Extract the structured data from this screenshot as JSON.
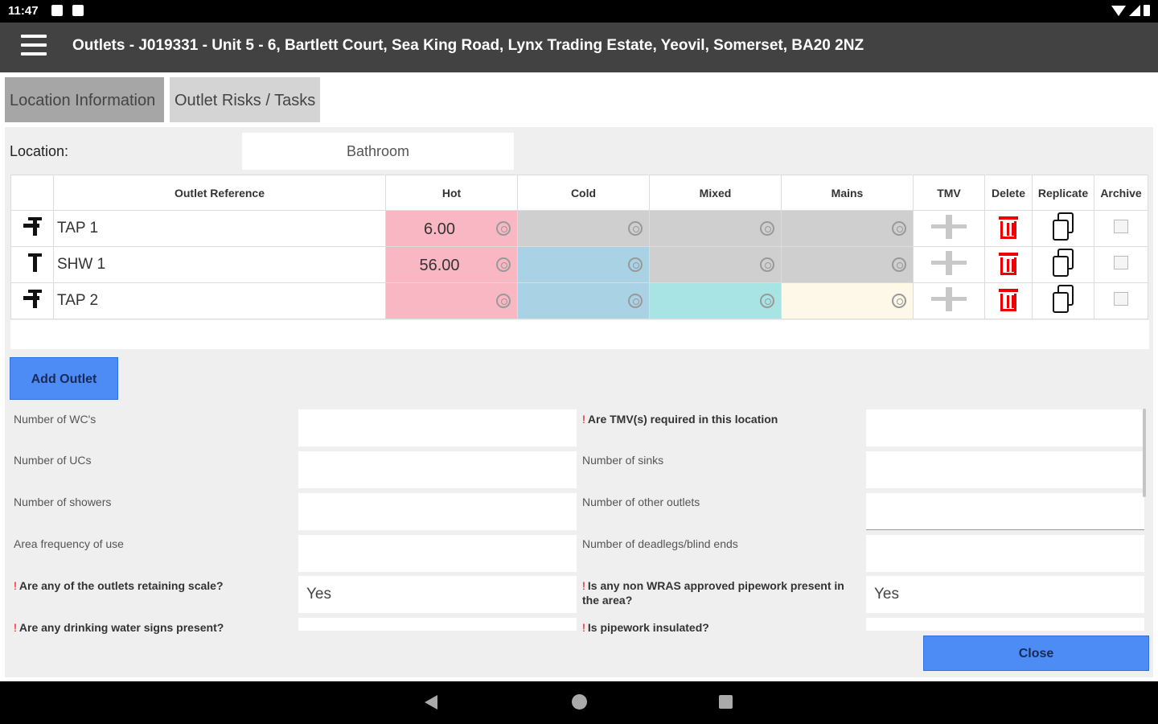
{
  "status_bar": {
    "time": "11:47"
  },
  "app_bar": {
    "title": "Outlets - J019331 - Unit 5 - 6, Bartlett Court, Sea King Road, Lynx Trading Estate, Yeovil, Somerset, BA20 2NZ"
  },
  "tabs": [
    {
      "label": "Location Information",
      "active": true
    },
    {
      "label": "Outlet Risks / Tasks",
      "active": false
    }
  ],
  "location": {
    "label": "Location:",
    "value": "Bathroom"
  },
  "table": {
    "headers": {
      "ref": "Outlet Reference",
      "hot": "Hot",
      "cold": "Cold",
      "mixed": "Mixed",
      "mains": "Mains",
      "tmv": "TMV",
      "delete": "Delete",
      "replicate": "Replicate",
      "archive": "Archive"
    },
    "rows": [
      {
        "icon": "tap-icon",
        "ref": "TAP 1",
        "hot": "6.00",
        "cold": "",
        "mixed": "",
        "mains": ""
      },
      {
        "icon": "shower-icon",
        "ref": "SHW 1",
        "hot": "56.00",
        "cold": "",
        "mixed": "",
        "mains": ""
      },
      {
        "icon": "tap-icon",
        "ref": "TAP 2",
        "hot": "",
        "cold": "",
        "mixed": "",
        "mains": ""
      }
    ]
  },
  "add_outlet_label": "Add Outlet",
  "form": {
    "num_wcs": {
      "label": "Number of WC's",
      "value": ""
    },
    "num_ucs": {
      "label": "Number of UCs",
      "value": ""
    },
    "num_showers": {
      "label": "Number of showers",
      "value": ""
    },
    "area_freq": {
      "label": "Area frequency of use",
      "value": ""
    },
    "retaining_scale": {
      "marker": "!",
      "label": "Are any of the outlets retaining scale?",
      "value": "Yes"
    },
    "drinking_signs": {
      "marker": "!",
      "label": "Are any drinking water signs present?",
      "value": ""
    },
    "tmv_required": {
      "marker": "!",
      "label": "Are TMV(s) required in this location",
      "value": ""
    },
    "num_sinks": {
      "label": "Number of sinks",
      "value": ""
    },
    "num_other": {
      "label": "Number of other outlets",
      "value": ""
    },
    "num_deadlegs": {
      "label": "Number of deadlegs/blind ends",
      "value": ""
    },
    "wras": {
      "marker": "!",
      "label": "Is any non WRAS approved pipework present in the area?",
      "value": "Yes"
    },
    "insulated": {
      "marker": "!",
      "label": "Is pipework insulated?",
      "value": ""
    }
  },
  "close_label": "Close",
  "colors": {
    "hot": "#f9b7c3",
    "cold": "#a9d2e4",
    "mixed": "#a9e4e4",
    "mains": "#fdf8e8",
    "disabled": "#cfcfcf",
    "button": "#4d8cf5",
    "app_bar": "#424242"
  }
}
